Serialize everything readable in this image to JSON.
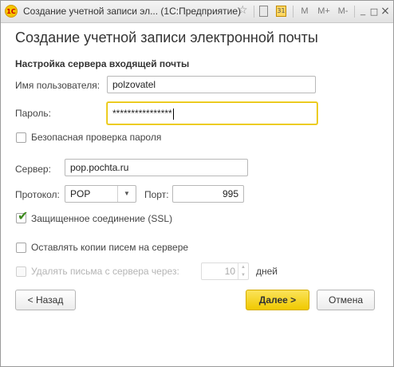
{
  "window": {
    "title": "Создание учетной записи эл...  (1С:Предприятие)",
    "app_icon_text": "1C",
    "toolbar": {
      "m_label": "M",
      "m_plus_label": "M+",
      "m_minus_label": "M-",
      "minimize_label": "_",
      "maximize_label": "□",
      "close_label": "×"
    }
  },
  "form": {
    "heading": "Создание учетной записи электронной почты",
    "section_title": "Настройка сервера входящей почты",
    "username": {
      "label": "Имя пользователя:",
      "value": "polzovatel"
    },
    "password": {
      "label": "Пароль:",
      "value": "****************"
    },
    "secure_password_check": {
      "label": "Безопасная проверка пароля",
      "checked": false
    },
    "server": {
      "label": "Сервер:",
      "value": "pop.pochta.ru"
    },
    "protocol": {
      "label": "Протокол:",
      "value": "POP"
    },
    "port": {
      "label": "Порт:",
      "value": "995"
    },
    "ssl": {
      "label": "Защищенное соединение (SSL)",
      "checked": true
    },
    "keep_copies": {
      "label": "Оставлять копии писем на сервере",
      "checked": false
    },
    "delete_after": {
      "label": "Удалять письма с сервера через:",
      "value": "10",
      "unit": "дней",
      "enabled": false
    }
  },
  "buttons": {
    "back": "< Назад",
    "next": "Далее >",
    "cancel": "Отмена"
  },
  "colors": {
    "accent_yellow": "#f0c900",
    "check_green": "#3d8a1e"
  }
}
